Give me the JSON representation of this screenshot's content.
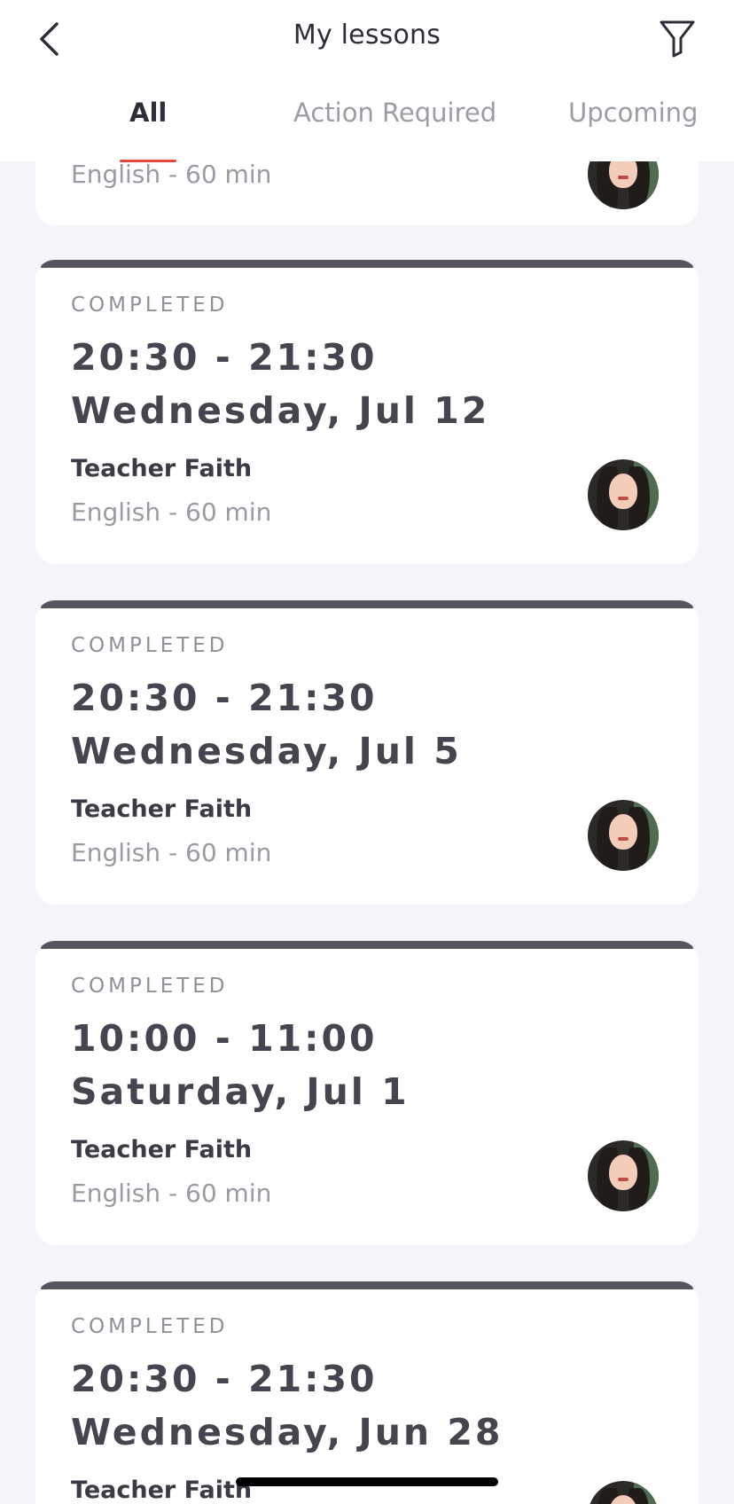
{
  "header": {
    "title": "My lessons",
    "tabs": [
      {
        "label": "All",
        "active": true
      },
      {
        "label": "Action Required",
        "active": false
      },
      {
        "label": "Upcoming",
        "active": false
      }
    ]
  },
  "lessons": [
    {
      "status": "",
      "time": "",
      "date": "",
      "teacher": "",
      "meta": "English - 60 min"
    },
    {
      "status": "COMPLETED",
      "time": "20:30 - 21:30",
      "date": "Wednesday, Jul 12",
      "teacher": "Teacher Faith",
      "meta": "English - 60 min"
    },
    {
      "status": "COMPLETED",
      "time": "20:30 - 21:30",
      "date": "Wednesday, Jul 5",
      "teacher": "Teacher Faith",
      "meta": "English - 60 min"
    },
    {
      "status": "COMPLETED",
      "time": "10:00 - 11:00",
      "date": "Saturday, Jul 1",
      "teacher": "Teacher Faith",
      "meta": "English - 60 min"
    },
    {
      "status": "COMPLETED",
      "time": "20:30 - 21:30",
      "date": "Wednesday, Jun 28",
      "teacher": "Teacher Faith",
      "meta": ""
    }
  ],
  "colors": {
    "accent": "#e8453c",
    "card_strip": "#55545f",
    "background": "#f4f5fa"
  },
  "icons": {
    "back": "chevron-left-icon",
    "filter": "filter-icon"
  }
}
